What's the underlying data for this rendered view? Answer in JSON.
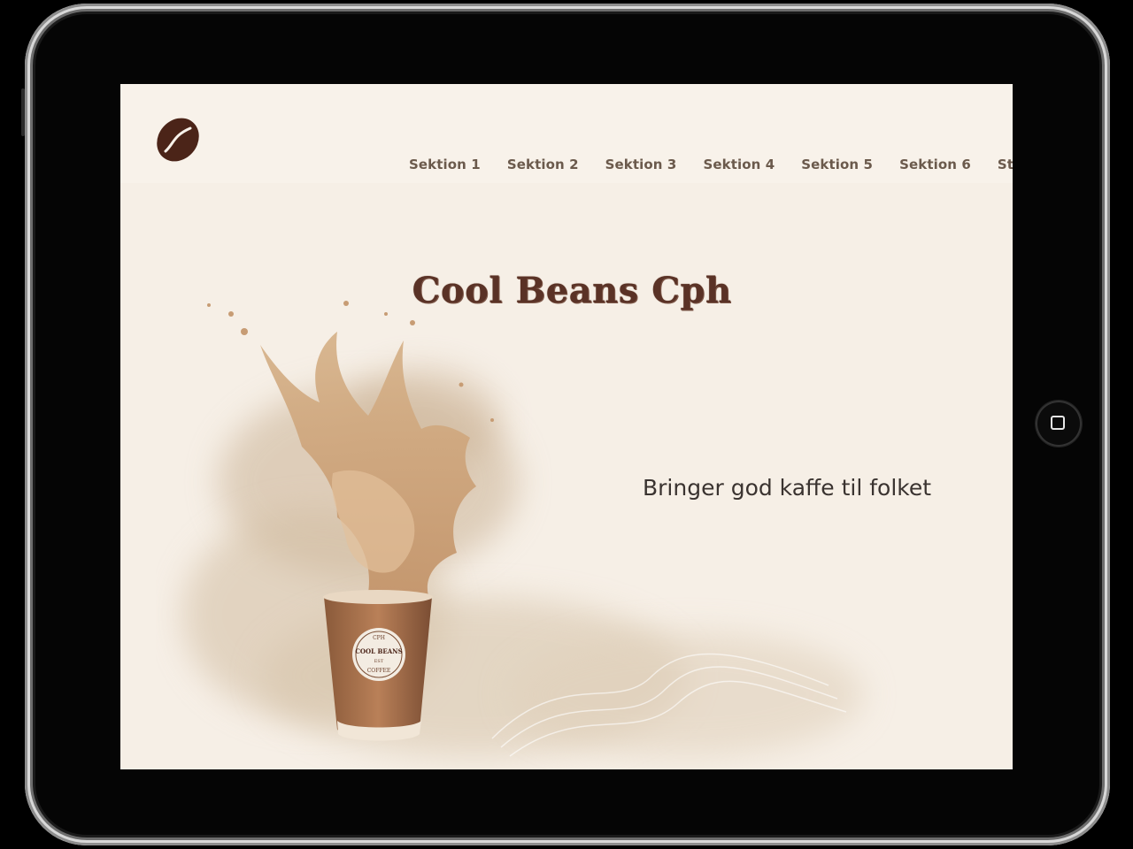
{
  "site": {
    "title": "Cool Beans Cph",
    "tagline": "Bringer god kaffe til folket"
  },
  "nav": {
    "items": [
      {
        "label": "Sektion 1"
      },
      {
        "label": "Sektion 2"
      },
      {
        "label": "Sektion 3"
      },
      {
        "label": "Sektion 4"
      },
      {
        "label": "Sektion 5"
      },
      {
        "label": "Sektion 6"
      },
      {
        "label": "Styletile"
      }
    ]
  },
  "cup": {
    "badge_top": "CPH",
    "badge_main": "COOL BEANS",
    "badge_mid": "EST",
    "badge_bottom": "COFFEE"
  },
  "icons": {
    "logo": "coffee-bean-icon",
    "home_button": "home-button-icon"
  },
  "colors": {
    "background": "#f6efe6",
    "header": "#f8f2ea",
    "nav_text": "#6b5a4c",
    "title": "#5a3226",
    "tagline": "#3a3330",
    "coffee": "#c8a07a",
    "bean": "#4b2418"
  }
}
